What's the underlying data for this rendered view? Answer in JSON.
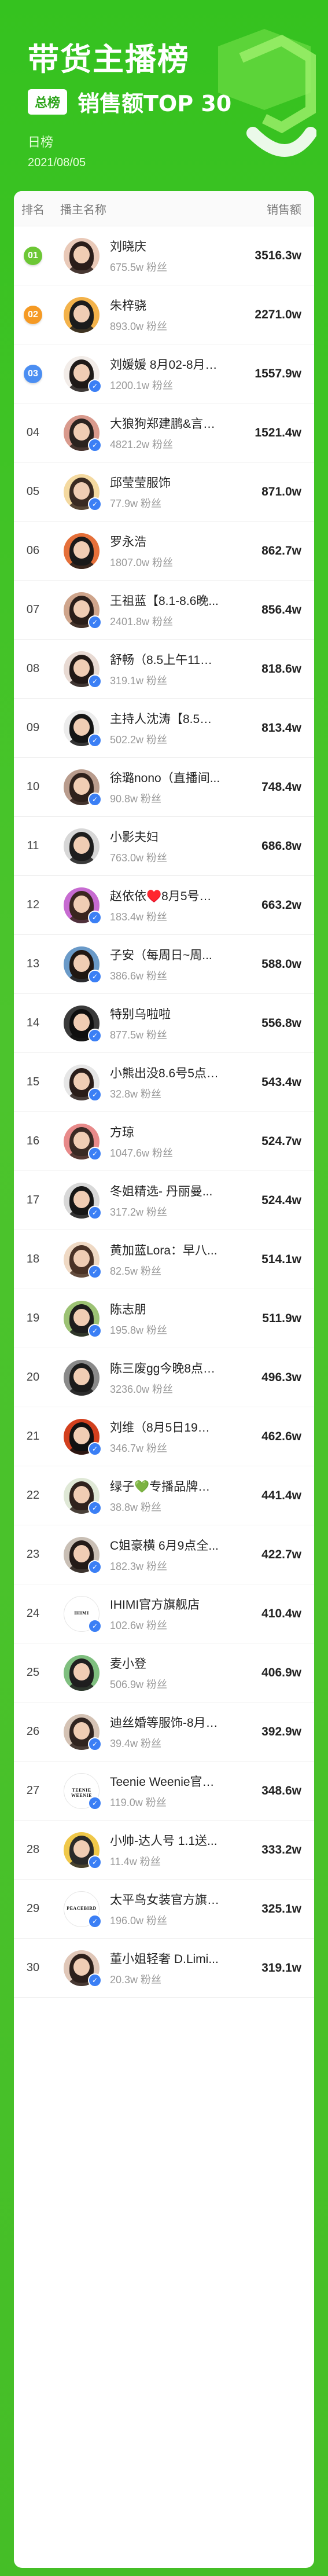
{
  "header": {
    "title": "带货主播榜",
    "tag": "总榜",
    "subtitle": "销售额TOP 30",
    "date_label": "日榜",
    "date": "2021/08/05"
  },
  "table": {
    "col_rank": "排名",
    "col_name": "播主名称",
    "col_sales": "销售额"
  },
  "colors": {
    "accent": "#35c21f",
    "medal_1": "#6cc735",
    "medal_2": "#f59a24",
    "medal_3": "#4b8ef2",
    "verify": "#3b7ff5"
  },
  "rows": [
    {
      "rank": "01",
      "name": "刘晓庆",
      "fans": "675.5w 粉丝",
      "sales": "3516.3w",
      "verified": false,
      "hair": "#2a1d1a",
      "bg": "#e9c9b8"
    },
    {
      "rank": "02",
      "name": "朱梓骁",
      "fans": "893.0w 粉丝",
      "sales": "2271.0w",
      "verified": false,
      "hair": "#1c1c1c",
      "bg": "#f3b24a"
    },
    {
      "rank": "03",
      "name": "刘媛媛 8月02-8月1...",
      "fans": "1200.1w 粉丝",
      "sales": "1557.9w",
      "verified": true,
      "hair": "#1f1a18",
      "bg": "#f2ece8"
    },
    {
      "rank": "04",
      "name": "大狼狗郑建鹏&言真...",
      "fans": "4821.2w 粉丝",
      "sales": "1521.4w",
      "verified": true,
      "hair": "#2b2320",
      "bg": "#d99a8d"
    },
    {
      "rank": "05",
      "name": "邱莹莹服饰",
      "fans": "77.9w 粉丝",
      "sales": "871.0w",
      "verified": true,
      "hair": "#3a2a22",
      "bg": "#f4d9a0"
    },
    {
      "rank": "06",
      "name": "罗永浩",
      "fans": "1807.0w 粉丝",
      "sales": "862.7w",
      "verified": false,
      "hair": "#1a1a1a",
      "bg": "#e5703a"
    },
    {
      "rank": "07",
      "name": "王祖蓝【8.1-8.6晚...",
      "fans": "2401.8w 粉丝",
      "sales": "856.4w",
      "verified": true,
      "hair": "#2a1e1a",
      "bg": "#cfa58c"
    },
    {
      "rank": "08",
      "name": "舒畅（8.5上午11点...",
      "fans": "319.1w 粉丝",
      "sales": "818.6w",
      "verified": true,
      "hair": "#221916",
      "bg": "#e8dad3"
    },
    {
      "rank": "09",
      "name": "主持人沈涛【8.5日...",
      "fans": "502.2w 粉丝",
      "sales": "813.4w",
      "verified": true,
      "hair": "#151515",
      "bg": "#ececec"
    },
    {
      "rank": "10",
      "name": "徐璐nono（直播间...",
      "fans": "90.8w 粉丝",
      "sales": "748.4w",
      "verified": true,
      "hair": "#2e211c",
      "bg": "#b99c8d"
    },
    {
      "rank": "11",
      "name": "小影夫妇",
      "fans": "763.0w 粉丝",
      "sales": "686.8w",
      "verified": false,
      "hair": "#1e1e1e",
      "bg": "#d7d7d7"
    },
    {
      "rank": "12",
      "name": "赵依依♥️8月5号工...",
      "fans": "183.4w 粉丝",
      "sales": "663.2w",
      "verified": true,
      "hair": "#3a2620",
      "bg": "#c76bd1"
    },
    {
      "rank": "13",
      "name": "子安（每周日~周...",
      "fans": "386.6w 粉丝",
      "sales": "588.0w",
      "verified": true,
      "hair": "#201713",
      "bg": "#6a9ac8"
    },
    {
      "rank": "14",
      "name": "特别乌啦啦",
      "fans": "877.5w 粉丝",
      "sales": "556.8w",
      "verified": true,
      "hair": "#0f0f0f",
      "bg": "#3a3a3a"
    },
    {
      "rank": "15",
      "name": "小熊出没8.6号5点A...",
      "fans": "32.8w 粉丝",
      "sales": "543.4w",
      "verified": true,
      "hair": "#2a1d19",
      "bg": "#e6e6e6"
    },
    {
      "rank": "16",
      "name": "方琼",
      "fans": "1047.6w 粉丝",
      "sales": "524.7w",
      "verified": true,
      "hair": "#3a2a24",
      "bg": "#e88a8a"
    },
    {
      "rank": "17",
      "name": "冬姐精选- 丹丽曼...",
      "fans": "317.2w 粉丝",
      "sales": "524.4w",
      "verified": true,
      "hair": "#171717",
      "bg": "#d8d8d8"
    },
    {
      "rank": "18",
      "name": "黄加蓝Lora：早八...",
      "fans": "82.5w 粉丝",
      "sales": "514.1w",
      "verified": true,
      "hair": "#4a3226",
      "bg": "#efd9c4"
    },
    {
      "rank": "19",
      "name": "陈志朋",
      "fans": "195.8w 粉丝",
      "sales": "511.9w",
      "verified": true,
      "hair": "#1d1d1d",
      "bg": "#9cc274"
    },
    {
      "rank": "20",
      "name": "陈三废gg今晚8点直播",
      "fans": "3236.0w 粉丝",
      "sales": "496.3w",
      "verified": false,
      "hair": "#1b1b1b",
      "bg": "#8a8a8a"
    },
    {
      "rank": "21",
      "name": "刘维（8月5日19：0...",
      "fans": "346.7w 粉丝",
      "sales": "462.6w",
      "verified": true,
      "hair": "#111111",
      "bg": "#d2401e"
    },
    {
      "rank": "22",
      "name": "绿子💚专播品牌女装~",
      "fans": "38.8w 粉丝",
      "sales": "441.4w",
      "verified": true,
      "hair": "#2f221d",
      "bg": "#dfe8d6"
    },
    {
      "rank": "23",
      "name": "C姐豪横 6月9点全...",
      "fans": "182.3w 粉丝",
      "sales": "422.7w",
      "verified": true,
      "hair": "#231b18",
      "bg": "#c9bfb5"
    },
    {
      "rank": "24",
      "name": "IHIMI官方旗舰店",
      "fans": "102.6w 粉丝",
      "sales": "410.4w",
      "verified": true,
      "hair": "#000000",
      "bg": "#ffffff",
      "logo": "IHIMI"
    },
    {
      "rank": "25",
      "name": "麦小登",
      "fans": "506.9w 粉丝",
      "sales": "406.9w",
      "verified": false,
      "hair": "#1f1f1f",
      "bg": "#7fbf7f"
    },
    {
      "rank": "26",
      "name": "迪丝婚等服饰-8月5...",
      "fans": "39.4w 粉丝",
      "sales": "392.9w",
      "verified": true,
      "hair": "#302420",
      "bg": "#d4c2b4"
    },
    {
      "rank": "27",
      "name": "Teenie Weenie官方...",
      "fans": "119.0w 粉丝",
      "sales": "348.6w",
      "verified": true,
      "hair": "#000000",
      "bg": "#ffffff",
      "logo": "TEENIE WEENIE"
    },
    {
      "rank": "28",
      "name": "小帅-达人号 1.1送...",
      "fans": "11.4w 粉丝",
      "sales": "333.2w",
      "verified": true,
      "hair": "#2a2a2a",
      "bg": "#f0c84a"
    },
    {
      "rank": "29",
      "name": "太平鸟女装官方旗舰店",
      "fans": "196.0w 粉丝",
      "sales": "325.1w",
      "verified": true,
      "hair": "#000000",
      "bg": "#ffffff",
      "logo": "PEACEBIRD"
    },
    {
      "rank": "30",
      "name": "董小姐轻奢 D.Limi...",
      "fans": "20.3w 粉丝",
      "sales": "319.1w",
      "verified": true,
      "hair": "#2d201b",
      "bg": "#e0c7b8"
    }
  ]
}
